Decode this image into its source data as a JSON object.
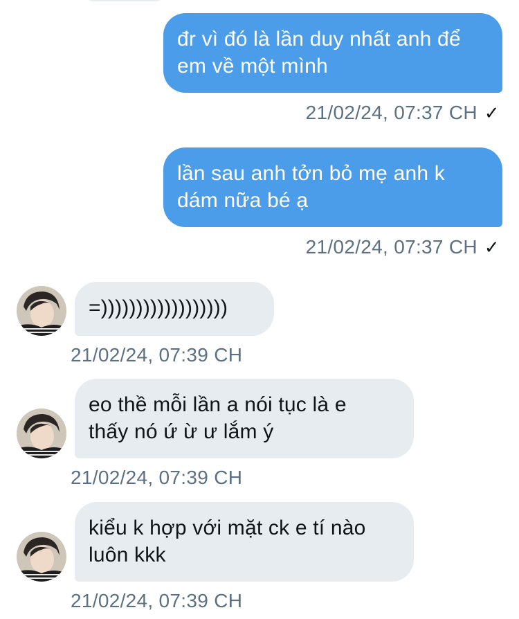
{
  "messages": [
    {
      "direction": "outgoing",
      "text": "đr vì đó là lần duy nhất anh để\nem về một mình",
      "timestamp": "21/02/24, 07:37 CH",
      "status_icon": "checkmark-icon",
      "status_glyph": "✓"
    },
    {
      "direction": "outgoing",
      "text": "lần sau anh tởn bỏ mẹ anh k\ndám nữa bé ạ",
      "timestamp": "21/02/24, 07:37 CH",
      "status_icon": "checkmark-icon",
      "status_glyph": "✓"
    },
    {
      "direction": "incoming",
      "text": "=))))))))))))))))))",
      "timestamp": "21/02/24, 07:39 CH",
      "avatar_icon": "avatar-photo"
    },
    {
      "direction": "incoming",
      "text": "eo thề mỗi lần a nói tục là e\nthấy nó ứ ừ ư lắm ý",
      "timestamp": "21/02/24, 07:39 CH",
      "avatar_icon": "avatar-photo"
    },
    {
      "direction": "incoming",
      "text": "kiểu k hợp với mặt ck e tí nào\nluôn kkk",
      "timestamp": "21/02/24, 07:39 CH",
      "avatar_icon": "avatar-photo"
    }
  ],
  "colors": {
    "outgoing_bubble": "#4c9de9",
    "incoming_bubble": "#e7ecf0",
    "timestamp_text": "#5b7083",
    "background": "#ffffff"
  }
}
